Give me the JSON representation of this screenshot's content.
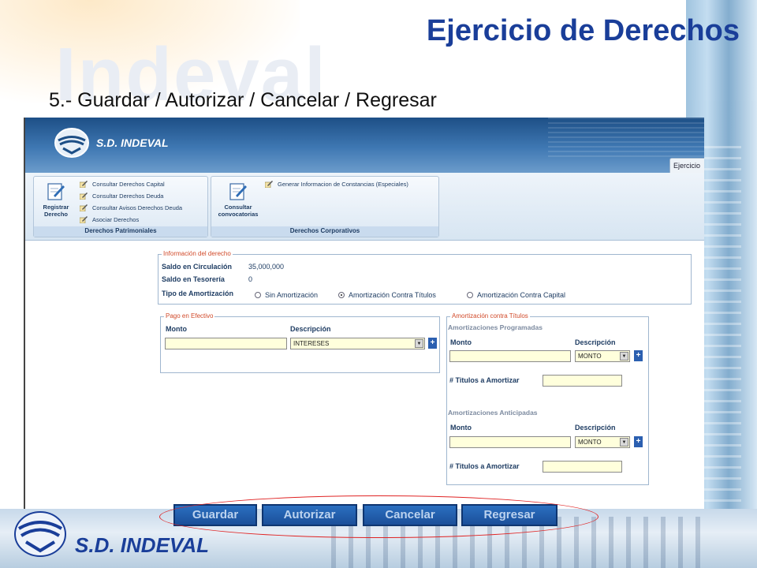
{
  "slide": {
    "title": "Ejercicio de Derechos",
    "subtitle": "5.- Guardar  /  Autorizar  /  Cancelar  /  Regresar",
    "watermark": "Indeval",
    "footer_brand": "S.D. INDEVAL"
  },
  "app": {
    "brand": "S.D. INDEVAL",
    "tab": "Ejercicio"
  },
  "ribbon": {
    "group1": {
      "label": "Derechos Patrimoniales",
      "big_button": "Registrar Derecho",
      "links": [
        "Consultar Derechos Capital",
        "Consultar Derechos Deuda",
        "Consultar Avisos Derechos Deuda",
        "Asociar Derechos"
      ]
    },
    "group2": {
      "label": "Derechos Corporativos",
      "big_button": "Consultar convocatorias",
      "links": [
        "Generar Informacion de Constancias (Especiales)"
      ]
    }
  },
  "info": {
    "legend": "Información del derecho",
    "saldo_circulacion_label": "Saldo en Circulación",
    "saldo_circulacion_value": "35,000,000",
    "saldo_tesoreria_label": "Saldo en Tesorería",
    "saldo_tesoreria_value": "0",
    "tipo_label": "Tipo de Amortización",
    "options": [
      "Sin Amortización",
      "Amortización Contra Títulos",
      "Amortización Contra Capital"
    ],
    "selected_option": "Amortización Contra Títulos"
  },
  "pago": {
    "legend": "Pago en Efectivo",
    "monto_label": "Monto",
    "descripcion_label": "Descripción",
    "monto_value": "",
    "descripcion_value": "INTERESES",
    "add_symbol": "+"
  },
  "amort": {
    "legend": "Amortización contra Títulos",
    "programadas_title": "Amortizaciones Programadas",
    "anticipadas_title": "Amortizaciones Anticipadas",
    "monto_label": "Monto",
    "descripcion_label": "Descripción",
    "descripcion_value": "MONTO",
    "titulos_label": "# Titulos a Amortizar",
    "add_symbol": "+"
  },
  "actions": {
    "guardar": "Guardar",
    "autorizar": "Autorizar",
    "cancelar": "Cancelar",
    "regresar": "Regresar"
  },
  "colors": {
    "title": "#1a3e99",
    "header": "#2d639f",
    "legend_text": "#d14a2a",
    "highlight": "#e02424",
    "input_bg": "#ffffdc"
  }
}
